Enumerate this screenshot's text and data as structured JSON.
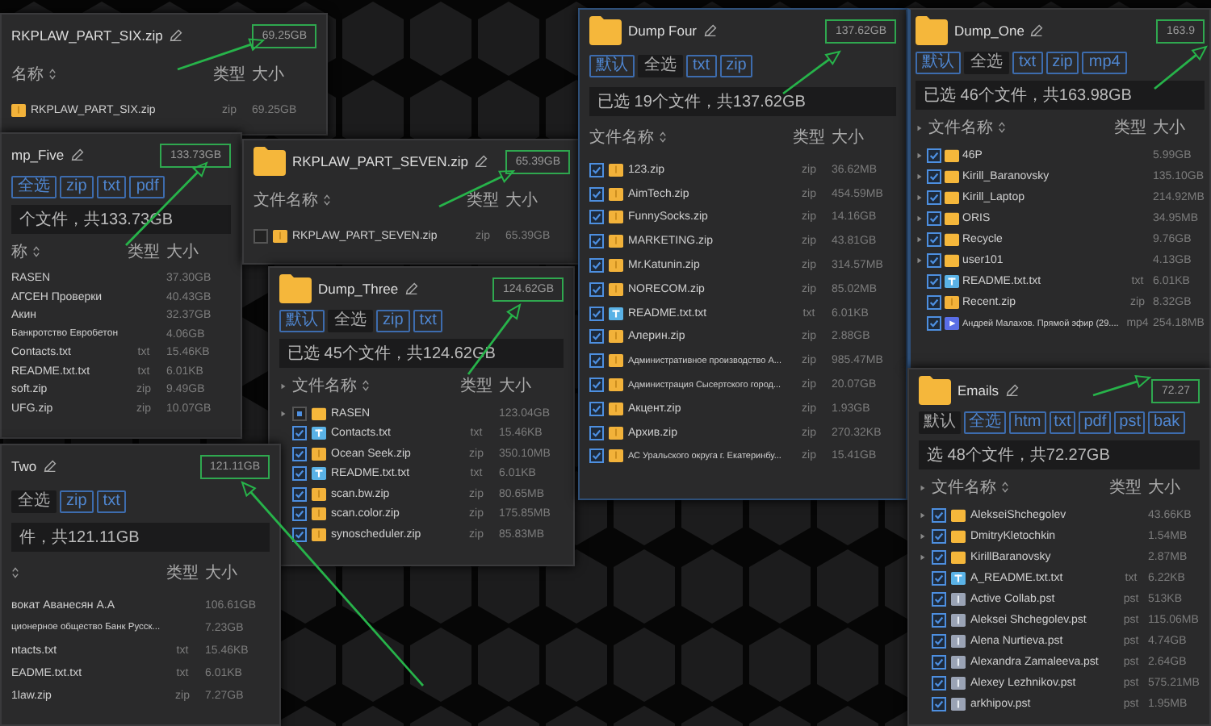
{
  "windows": [
    {
      "title": "RKPLAW_PART_SIX.zip",
      "show_icon": false,
      "total": "69.25GB",
      "columns": {
        "name": "名称",
        "type": "类型",
        "size": "大小"
      },
      "rows": [
        {
          "name": "RKPLAW_PART_SIX.zip",
          "type": "zip",
          "size": "69.25GB",
          "kind": "zip"
        }
      ]
    },
    {
      "title": "mp_Five",
      "show_icon": false,
      "total": "133.73GB",
      "filters": [
        {
          "label": "全选",
          "selected": false
        },
        {
          "label": "zip",
          "selected": false
        },
        {
          "label": "txt",
          "selected": false
        },
        {
          "label": "pdf",
          "selected": false
        }
      ],
      "summary": "个文件，共133.73GB",
      "columns": {
        "name": "称",
        "type": "类型",
        "size": "大小"
      },
      "rows": [
        {
          "name": "RASEN",
          "size": "37.30GB"
        },
        {
          "name": "АГСЕН Проверки",
          "size": "40.43GB"
        },
        {
          "name": "Акин",
          "size": "32.37GB"
        },
        {
          "name": "Банкротство Евробетон",
          "size": "4.06GB"
        },
        {
          "name": "Contacts.txt",
          "type": "txt",
          "size": "15.46KB"
        },
        {
          "name": "README.txt.txt",
          "type": "txt",
          "size": "6.01KB"
        },
        {
          "name": "soft.zip",
          "type": "zip",
          "size": "9.49GB"
        },
        {
          "name": "UFG.zip",
          "type": "zip",
          "size": "10.07GB"
        }
      ]
    },
    {
      "title": "RKPLAW_PART_SEVEN.zip",
      "show_icon": true,
      "total": "65.39GB",
      "columns": {
        "name": "文件名称",
        "type": "类型",
        "size": "大小"
      },
      "rows": [
        {
          "name": "RKPLAW_PART_SEVEN.zip",
          "type": "zip",
          "size": "65.39GB",
          "kind": "zip",
          "checked": false
        }
      ]
    },
    {
      "title": "Dump_Three",
      "show_icon": true,
      "total": "124.62GB",
      "filters": [
        {
          "label": "默认",
          "selected": false
        },
        {
          "label": "全选",
          "selected": true
        },
        {
          "label": "zip",
          "selected": false
        },
        {
          "label": "txt",
          "selected": false
        }
      ],
      "summary": "已选 45个文件，共124.62GB",
      "columns": {
        "name": "文件名称",
        "type": "类型",
        "size": "大小"
      },
      "rows": [
        {
          "name": "RASEN",
          "size": "123.04GB",
          "kind": "folder",
          "checked": false,
          "partial": true,
          "expandable": true
        },
        {
          "name": "Contacts.txt",
          "type": "txt",
          "size": "15.46KB",
          "kind": "txt",
          "checked": true,
          "partial": false,
          "expandable": false
        },
        {
          "name": "Ocean Seek.zip",
          "type": "zip",
          "size": "350.10MB",
          "kind": "zip",
          "checked": true,
          "partial": false,
          "expandable": false
        },
        {
          "name": "README.txt.txt",
          "type": "txt",
          "size": "6.01KB",
          "kind": "txt",
          "checked": true,
          "partial": false,
          "expandable": false
        },
        {
          "name": "scan.bw.zip",
          "type": "zip",
          "size": "80.65MB",
          "kind": "zip",
          "checked": true,
          "partial": false,
          "expandable": false
        },
        {
          "name": "scan.color.zip",
          "type": "zip",
          "size": "175.85MB",
          "kind": "zip",
          "checked": true,
          "partial": false,
          "expandable": false
        },
        {
          "name": "synoscheduler.zip",
          "type": "zip",
          "size": "85.83MB",
          "kind": "zip",
          "checked": true,
          "partial": false,
          "expandable": false
        }
      ]
    },
    {
      "title": "Two",
      "show_icon": false,
      "total": "121.11GB",
      "filters": [
        {
          "label": "全选",
          "selected": true
        },
        {
          "label": "zip",
          "selected": false
        },
        {
          "label": "txt",
          "selected": false
        }
      ],
      "summary": "件，共121.11GB",
      "columns": {
        "type": "类型",
        "size": "大小"
      },
      "rows": [
        {
          "name": "вокат Аванесян А.А",
          "size": "106.61GB"
        },
        {
          "name": "ционерное общество Банк Русск...",
          "size": "7.23GB"
        },
        {
          "name": "ntacts.txt",
          "type": "txt",
          "size": "15.46KB"
        },
        {
          "name": "EADME.txt.txt",
          "type": "txt",
          "size": "6.01KB"
        },
        {
          "name": "1law.zip",
          "type": "zip",
          "size": "7.27GB"
        }
      ]
    },
    {
      "title": "Dump Four",
      "show_icon": true,
      "total": "137.62GB",
      "filters": [
        {
          "label": "默认",
          "selected": false
        },
        {
          "label": "全选",
          "selected": true
        },
        {
          "label": "txt",
          "selected": false
        },
        {
          "label": "zip",
          "selected": false
        }
      ],
      "summary": "已选 19个文件，共137.62GB",
      "columns": {
        "name": "文件名称",
        "type": "类型",
        "size": "大小"
      },
      "rows": [
        {
          "name": "123.zip",
          "type": "zip",
          "size": "36.62MB",
          "kind": "zip",
          "checked": true
        },
        {
          "name": "AimTech.zip",
          "type": "zip",
          "size": "454.59MB",
          "kind": "zip",
          "checked": true
        },
        {
          "name": "FunnySocks.zip",
          "type": "zip",
          "size": "14.16GB",
          "kind": "zip",
          "checked": true
        },
        {
          "name": "MARKETING.zip",
          "type": "zip",
          "size": "43.81GB",
          "kind": "zip",
          "checked": true
        },
        {
          "name": "Mr.Katunin.zip",
          "type": "zip",
          "size": "314.57MB",
          "kind": "zip",
          "checked": true
        },
        {
          "name": "NORECOM.zip",
          "type": "zip",
          "size": "85.02MB",
          "kind": "zip",
          "checked": true
        },
        {
          "name": "README.txt.txt",
          "type": "txt",
          "size": "6.01KB",
          "kind": "txt",
          "checked": true
        },
        {
          "name": "Алерин.zip",
          "type": "zip",
          "size": "2.88GB",
          "kind": "zip",
          "checked": true
        },
        {
          "name": "Административное производство А...",
          "type": "zip",
          "size": "985.47MB",
          "kind": "zip",
          "checked": true
        },
        {
          "name": "Администрация Сысертского город...",
          "type": "zip",
          "size": "20.07GB",
          "kind": "zip",
          "checked": true
        },
        {
          "name": "Акцент.zip",
          "type": "zip",
          "size": "1.93GB",
          "kind": "zip",
          "checked": true
        },
        {
          "name": "Архив.zip",
          "type": "zip",
          "size": "270.32KB",
          "kind": "zip",
          "checked": true
        },
        {
          "name": "АС Уральского округа г. Екатеринбу...",
          "type": "zip",
          "size": "15.41GB",
          "kind": "zip",
          "checked": true
        }
      ]
    },
    {
      "title": "Dump_One",
      "show_icon": true,
      "total": "163.9",
      "filters": [
        {
          "label": "默认",
          "selected": false
        },
        {
          "label": "全选",
          "selected": true
        },
        {
          "label": "txt",
          "selected": false
        },
        {
          "label": "zip",
          "selected": false
        },
        {
          "label": "mp4",
          "selected": false
        }
      ],
      "summary": "已选 46个文件，共163.98GB",
      "columns": {
        "name": "文件名称",
        "type": "类型",
        "size": "大小"
      },
      "rows": [
        {
          "name": "46P",
          "size": "5.99GB",
          "kind": "folder",
          "checked": true,
          "expandable": true
        },
        {
          "name": "Kirill_Baranovsky",
          "size": "135.10GB",
          "kind": "folder",
          "checked": true,
          "expandable": true
        },
        {
          "name": "Kirill_Laptop",
          "size": "214.92MB",
          "kind": "folder",
          "checked": true,
          "expandable": true
        },
        {
          "name": "ORIS",
          "size": "34.95MB",
          "kind": "folder",
          "checked": true,
          "expandable": true
        },
        {
          "name": "Recycle",
          "size": "9.76GB",
          "kind": "folder",
          "checked": true,
          "expandable": true
        },
        {
          "name": "user101",
          "size": "4.13GB",
          "kind": "folder",
          "checked": true,
          "expandable": true
        },
        {
          "name": "README.txt.txt",
          "type": "txt",
          "size": "6.01KB",
          "kind": "txt",
          "checked": true,
          "expandable": false
        },
        {
          "name": "Recent.zip",
          "type": "zip",
          "size": "8.32GB",
          "kind": "zip",
          "checked": true,
          "expandable": false
        },
        {
          "name": "Андрей Малахов. Прямой эфир (29....",
          "type": "mp4",
          "size": "254.18MB",
          "kind": "video",
          "checked": true,
          "expandable": false
        }
      ]
    },
    {
      "title": "Emails",
      "show_icon": true,
      "total": "72.27",
      "filters": [
        {
          "label": "默认",
          "selected": true
        },
        {
          "label": "全选",
          "selected": false
        },
        {
          "label": "htm",
          "selected": false
        },
        {
          "label": "txt",
          "selected": false
        },
        {
          "label": "pdf",
          "selected": false
        },
        {
          "label": "pst",
          "selected": false
        },
        {
          "label": "bak",
          "selected": false
        }
      ],
      "summary": "选 48个文件，共72.27GB",
      "columns": {
        "name": "文件名称",
        "type": "类型",
        "size": "大小"
      },
      "rows": [
        {
          "name": "AlekseiShchegolev",
          "size": "43.66KB",
          "kind": "folder",
          "checked": true,
          "expandable": true
        },
        {
          "name": "DmitryKletochkin",
          "size": "1.54MB",
          "kind": "folder",
          "checked": true,
          "expandable": true
        },
        {
          "name": "KirillBaranovsky",
          "size": "2.87MB",
          "kind": "folder",
          "checked": true,
          "expandable": true
        },
        {
          "name": "A_README.txt.txt",
          "type": "txt",
          "size": "6.22KB",
          "kind": "txt",
          "checked": true,
          "expandable": false
        },
        {
          "name": "Active Collab.pst",
          "type": "pst",
          "size": "513KB",
          "kind": "pst",
          "checked": true,
          "expandable": false
        },
        {
          "name": "Aleksei Shchegolev.pst",
          "type": "pst",
          "size": "115.06MB",
          "kind": "pst",
          "checked": true,
          "expandable": false
        },
        {
          "name": "Alena Nurtieva.pst",
          "type": "pst",
          "size": "4.74GB",
          "kind": "pst",
          "checked": true,
          "expandable": false
        },
        {
          "name": "Alexandra Zamaleeva.pst",
          "type": "pst",
          "size": "2.64GB",
          "kind": "pst",
          "checked": true,
          "expandable": false
        },
        {
          "name": "Alexey Lezhnikov.pst",
          "type": "pst",
          "size": "575.21MB",
          "kind": "pst",
          "checked": true,
          "expandable": false
        },
        {
          "name": "arkhipov.pst",
          "type": "pst",
          "size": "1.95MB",
          "kind": "pst",
          "checked": true,
          "expandable": false
        }
      ]
    }
  ]
}
